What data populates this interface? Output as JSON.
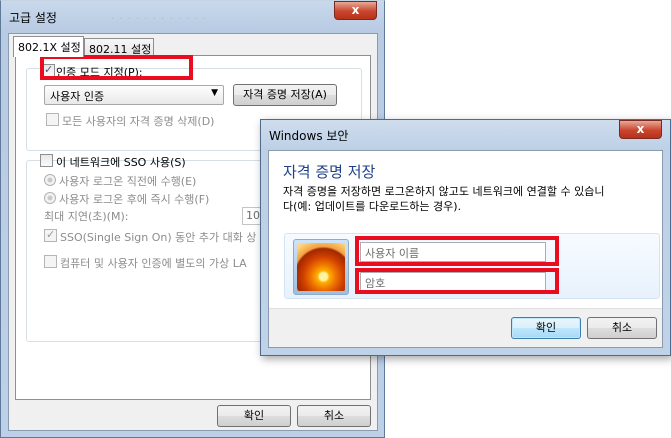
{
  "advanced_dialog": {
    "title": "고급 설정",
    "close_label": "x",
    "tabs": [
      {
        "label": "802.1X 설정"
      },
      {
        "label": "802.11 설정"
      }
    ],
    "specify_auth_mode_label": "인증 모드 지정(P):",
    "auth_mode_selected": "사용자 인증",
    "save_credentials_button": "자격 증명 저장(A)",
    "delete_all_credentials_label": "모든 사용자의 자격 증명 삭제(D)",
    "enable_sso_label": "이 네트워크에 SSO 사용(S)",
    "sso_before_logon_label": "사용자 로그온 직전에 수행(E)",
    "sso_after_logon_label": "사용자 로그온 후에 즉시 수행(F)",
    "max_delay_label": "최대 지연(초)(M):",
    "max_delay_value": "10",
    "allow_extra_dialogs_label": "SSO(Single Sign On) 동안 추가 대화 상",
    "separate_vlan_label": "컴퓨터 및 사용자 인증에 별도의 가상 LA",
    "ok_button": "확인",
    "cancel_button": "취소"
  },
  "security_dialog": {
    "title": "Windows 보안",
    "close_label": "x",
    "heading": "자격 증명 저장",
    "message_line1": "자격 증명을 저장하면 로그온하지 않고도 네트워크에 연결할 수 있습니",
    "message_line2": "다(예: 업데이트를 다운로드하는 경우).",
    "username_placeholder": "사용자 이름",
    "password_placeholder": "암호",
    "ok_button": "확인",
    "cancel_button": "취소"
  },
  "colors": {
    "highlight": "#ea0c1f",
    "heading_blue": "#1e3f8a",
    "close_red": "#c9452d"
  }
}
